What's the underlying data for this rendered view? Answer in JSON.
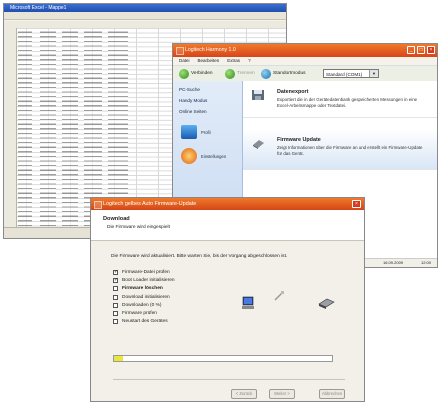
{
  "spreadsheet": {
    "title": "Microsoft Excel - Mappe1"
  },
  "app": {
    "title": "Logitech Harmony 1.0",
    "menu": [
      "Datei",
      "Bearbeiten",
      "Extras",
      "?"
    ],
    "toolbar": {
      "connect_label": "Verbinden",
      "disconnect_label": "Trennen",
      "status_label": "Standortmodus",
      "dropdown_value": "Standard (COM1)"
    },
    "sidebar": {
      "items": [
        "PC-Suche",
        "Handy Modus",
        "Online Seiten"
      ],
      "sub1": "Profil",
      "sub2": "Einstellungen"
    },
    "rows": [
      {
        "title": "Datenexport",
        "desc": "Exportiert die in der Gerätedatenbank gespeicherten Messungen in eine Excel-Arbeitsmappe oder Textdatei."
      },
      {
        "title": "Firmware Update",
        "desc": "Zeigt Informationen über die Firmware an und erstellt ein Firmware-Update für das Gerät."
      }
    ],
    "statusbar": {
      "date": "16.09.2009",
      "time": "12:00"
    }
  },
  "dialog": {
    "title": "Logitech gelbes Auto Firmware-Update",
    "heading": "Download",
    "subheading": "Die Firmware wird eingespielt",
    "message": "Die Firmware wird aktualisiert. Bitte warten Sie, bis der Vorgang abgeschlossen ist.",
    "steps": [
      {
        "label": "Firmware-Datei prüfen",
        "checked": true,
        "bold": false
      },
      {
        "label": "Boot Loader initialisieren",
        "checked": true,
        "bold": false
      },
      {
        "label": "Firmware löschen",
        "checked": false,
        "bold": true
      },
      {
        "label": "Download initialisieren",
        "checked": false,
        "bold": false
      },
      {
        "label": "Downloaden (0 %)",
        "checked": false,
        "bold": false
      },
      {
        "label": "Firmware prüfen",
        "checked": false,
        "bold": false
      },
      {
        "label": "Neustart des Gerätes",
        "checked": false,
        "bold": false
      }
    ],
    "progress": 0.04,
    "buttons": [
      "< Zurück",
      "Weiter >",
      "Abbrechen"
    ],
    "accent": "#e05a20"
  }
}
